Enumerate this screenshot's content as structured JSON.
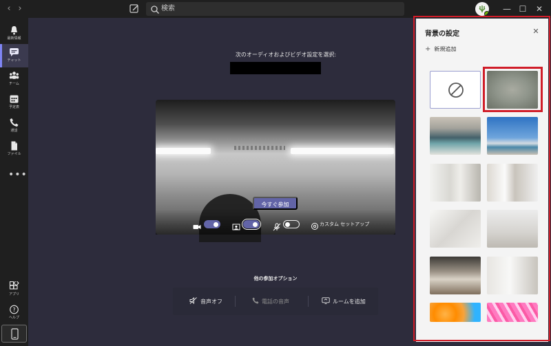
{
  "titlebar": {
    "search_placeholder": "検索",
    "nav_back": "‹",
    "nav_forward": "›",
    "minimize": "—",
    "maximize": "☐",
    "close": "✕"
  },
  "rail": {
    "items": [
      {
        "label": "最新情報",
        "icon": "bell-icon"
      },
      {
        "label": "チャット",
        "icon": "chat-icon"
      },
      {
        "label": "チーム",
        "icon": "teams-icon"
      },
      {
        "label": "予定表",
        "icon": "calendar-icon"
      },
      {
        "label": "通話",
        "icon": "phone-icon"
      },
      {
        "label": "ファイル",
        "icon": "file-icon"
      }
    ],
    "more": "•••",
    "apps_label": "アプリ",
    "help_label": "ヘルプ"
  },
  "main": {
    "prompt": "次のオーディオおよびビデオ設定を選択:",
    "join_button": "今すぐ参加",
    "controls": {
      "camera_on": true,
      "blur_on": true,
      "mic_on": false,
      "custom_setup": "カスタム セットアップ"
    },
    "other_options_title": "他の参加オプション",
    "options": [
      {
        "label": "音声オフ",
        "icon": "speaker-off-icon",
        "enabled": true
      },
      {
        "label": "電話の音声",
        "icon": "phone-icon",
        "enabled": false
      },
      {
        "label": "ルームを追加",
        "icon": "cast-icon",
        "enabled": true
      }
    ]
  },
  "bg_panel": {
    "title": "背景の設定",
    "close": "✕",
    "add_new": "新規追加",
    "add_new_plus": "+",
    "selected_index": 1,
    "thumbnails": [
      "none",
      "blur",
      "office-1",
      "sky",
      "room-1",
      "room-2",
      "room-3",
      "room-4",
      "office-2",
      "room-5",
      "orange-balls",
      "pink-pattern"
    ]
  },
  "colors": {
    "accent": "#6264a7",
    "highlight": "#d01c28",
    "rail_bg": "#1f1f1f",
    "main_bg": "#2d2c3c",
    "panel_bg": "#f4f4f4"
  }
}
